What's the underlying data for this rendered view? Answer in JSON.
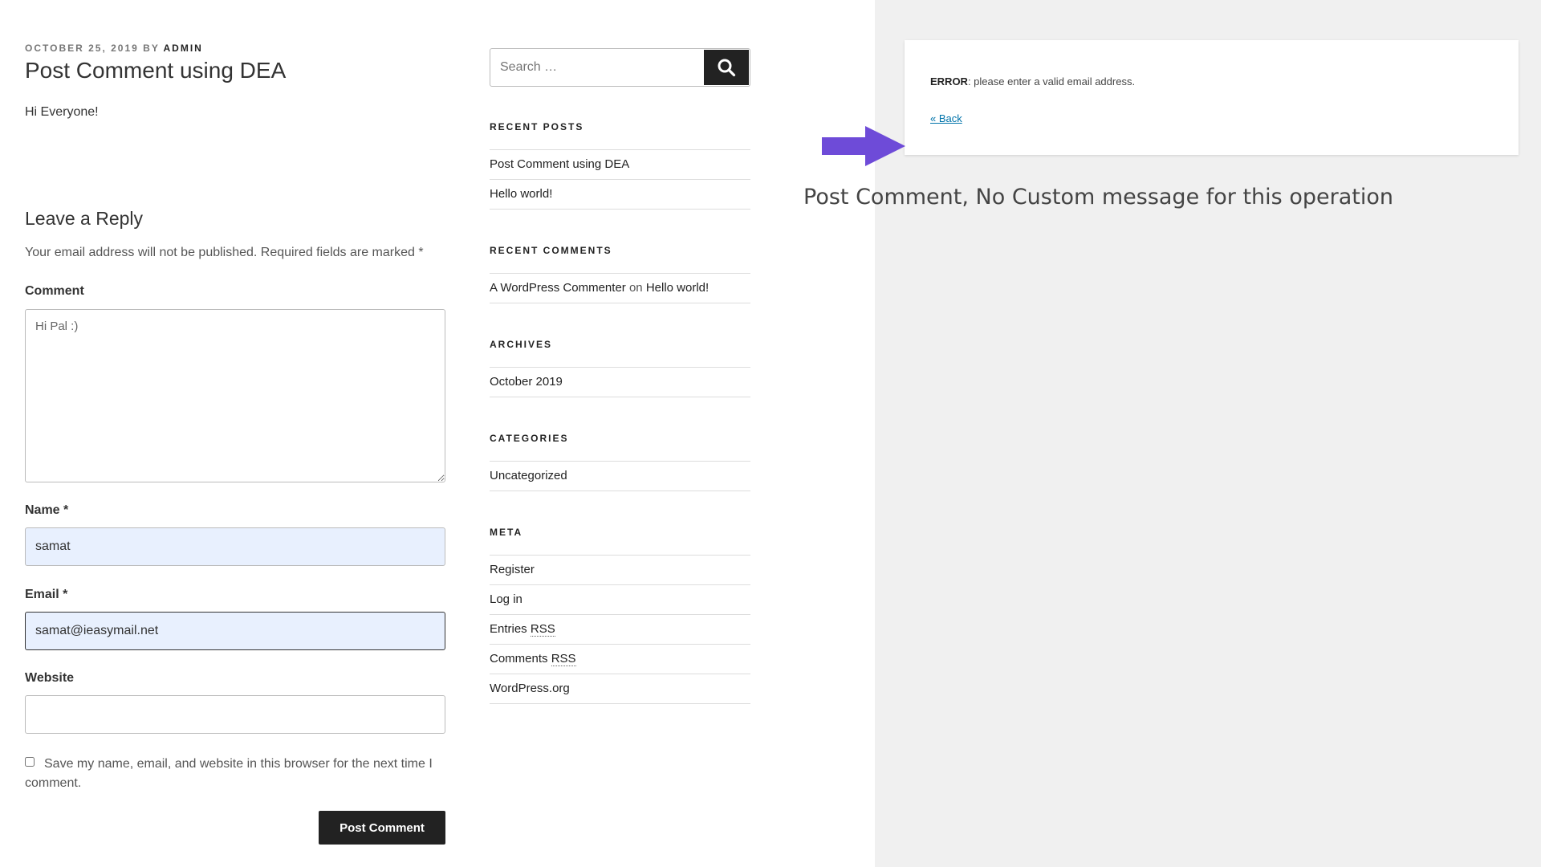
{
  "post": {
    "date": "OCTOBER 25, 2019",
    "by": "BY",
    "author": "ADMIN",
    "title": "Post Comment using DEA",
    "body": "Hi Everyone!"
  },
  "comment_form": {
    "reply_title": "Leave a Reply",
    "notes": "Your email address will not be published. Required fields are marked *",
    "comment_label": "Comment",
    "comment_value": "Hi Pal :)",
    "name_label": "Name *",
    "name_value": "samat",
    "email_label": "Email *",
    "email_value": "samat@ieasymail.net",
    "website_label": "Website",
    "website_value": "",
    "cookies_label": "Save my name, email, and website in this browser for the next time I comment.",
    "cookies_checked": false,
    "submit_label": "Post Comment"
  },
  "sidebar": {
    "search": {
      "placeholder": "Search …",
      "icon": "search-icon"
    },
    "recent_posts": {
      "title": "RECENT POSTS",
      "items": [
        "Post Comment using DEA",
        "Hello world!"
      ]
    },
    "recent_comments": {
      "title": "RECENT COMMENTS",
      "author": "A WordPress Commenter",
      "on": "on",
      "post": "Hello world!"
    },
    "archives": {
      "title": "ARCHIVES",
      "items": [
        "October 2019"
      ]
    },
    "categories": {
      "title": "CATEGORIES",
      "items": [
        "Uncategorized"
      ]
    },
    "meta": {
      "title": "META",
      "items": [
        {
          "pre": "Register",
          "abbr": ""
        },
        {
          "pre": "Log in",
          "abbr": ""
        },
        {
          "pre": "Entries ",
          "abbr": "RSS"
        },
        {
          "pre": "Comments ",
          "abbr": "RSS"
        },
        {
          "pre": "WordPress.org",
          "abbr": ""
        }
      ]
    }
  },
  "error_panel": {
    "error_label": "ERROR",
    "error_message": ": please enter a valid email address.",
    "back_link": "« Back",
    "caption": "Post Comment, No Custom message for this operation",
    "arrow_color": "#6e4bd8"
  }
}
